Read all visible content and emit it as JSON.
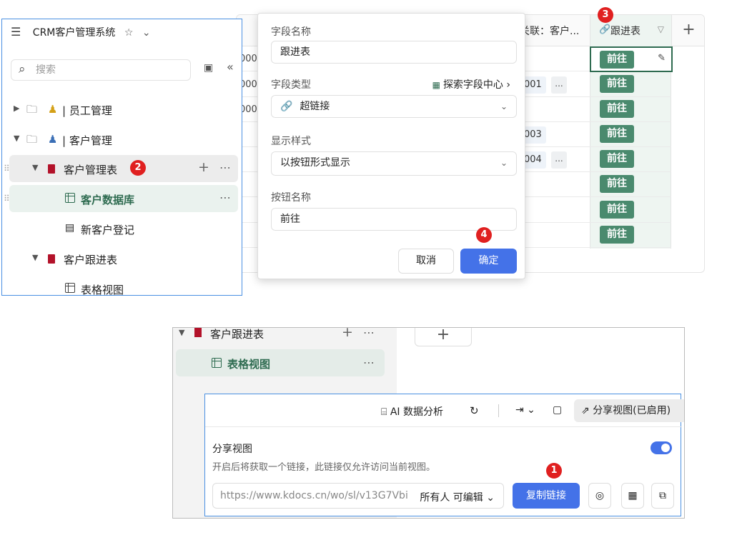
{
  "background_table": {
    "header_relation": "关联：客户...",
    "header_link_label": "跟进表",
    "header_plus": "+",
    "goto_label": "前往",
    "id_fragment": "000",
    "chips": [
      "001",
      "003",
      "004"
    ],
    "more": "..."
  },
  "sidebar": {
    "title": "CRM客户管理系统",
    "search_placeholder": "搜索",
    "items": [
      {
        "label": "| 员工管理"
      },
      {
        "label": "| 客户管理"
      },
      {
        "label": "客户管理表"
      },
      {
        "label": "客户数据库"
      },
      {
        "label": "新客户登记"
      },
      {
        "label": "客户跟进表"
      },
      {
        "label": "表格视图"
      }
    ]
  },
  "dialog": {
    "field_name_label": "字段名称",
    "field_name_value": "跟进表",
    "field_type_label": "字段类型",
    "explore_label": "探索字段中心",
    "field_type_value": "超链接",
    "display_style_label": "显示样式",
    "display_style_value": "以按钮形式显示",
    "button_name_label": "按钮名称",
    "button_name_value": "前往",
    "cancel_label": "取消",
    "ok_label": "确定"
  },
  "lower": {
    "tree_item_1": "客户跟进表",
    "tree_item_2": "表格视图",
    "tab_plus": "+",
    "toolbar": {
      "ai_analysis": "AI 数据分析",
      "share_view_enabled": "分享视图(已启用)"
    },
    "share": {
      "title": "分享视图",
      "description": "开启后将获取一个链接，此链接仅允许访问当前视图。",
      "url": "https://www.kdocs.cn/wo/sl/v13G7Vbi",
      "permission": "所有人 可编辑",
      "copy_label": "复制链接",
      "toggle_on": true
    }
  },
  "badges": [
    "1",
    "2",
    "3",
    "4"
  ],
  "colors": {
    "accent_blue": "#4472e8",
    "brand_green": "#2e6b50",
    "goto_button_green": "#4a8a6e",
    "badge_red": "#e02020",
    "book_red": "#b3122a"
  }
}
